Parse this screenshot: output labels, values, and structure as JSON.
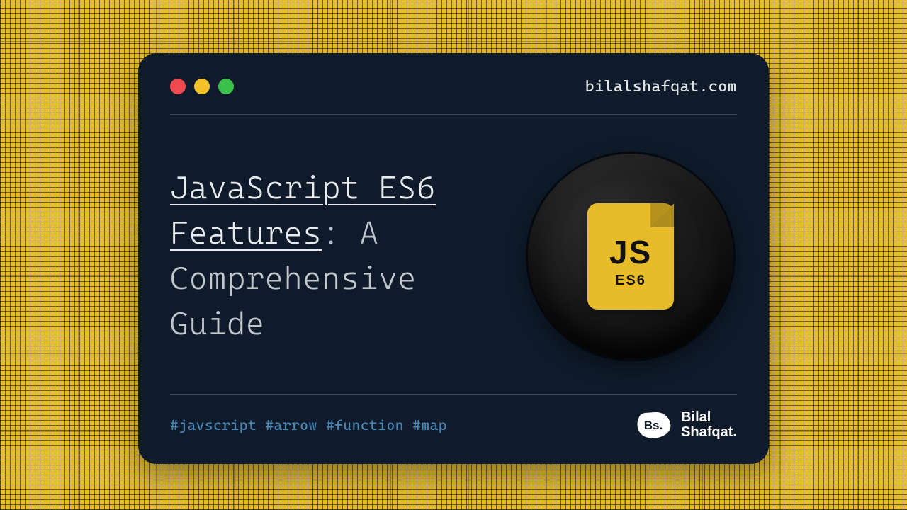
{
  "header": {
    "domain_text": "bilalshafqat.com"
  },
  "traffic_lights": {
    "red": "#ee4a50",
    "yellow": "#f4c22b",
    "green": "#3cc04c"
  },
  "title": {
    "underlined": "JavaScript ES6 Features",
    "rest": ": A Comprehensive Guide"
  },
  "js_icon": {
    "big": "JS",
    "small": "ES6"
  },
  "tags_line": "#javscript #arrow #function #map",
  "brand": {
    "blob_initials": "Bs.",
    "line1": "Bilal",
    "line2": "Shafqat."
  },
  "colors": {
    "bg_yellow": "#e8bb28",
    "card_bg": "#0f1b2a",
    "tag_blue": "#4a86b3",
    "rule_grey": "#3a4654"
  }
}
